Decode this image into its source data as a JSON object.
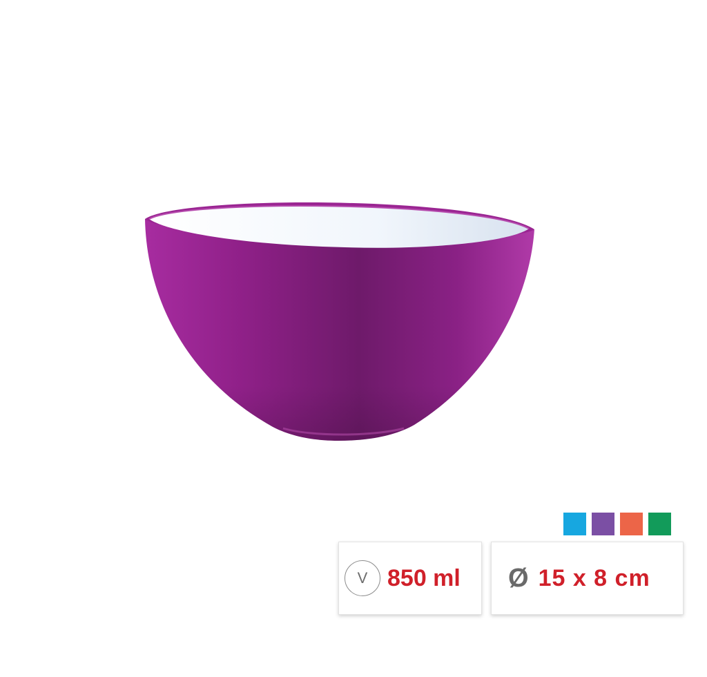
{
  "product": {
    "image_name": "purple-bowl",
    "body_color": "#8c1f85",
    "interior_color": "#eef4fb"
  },
  "color_options": [
    {
      "name": "blue",
      "hex": "#17a7e0"
    },
    {
      "name": "purple",
      "hex": "#7b4fa4"
    },
    {
      "name": "orange",
      "hex": "#ec6548"
    },
    {
      "name": "green",
      "hex": "#129b5a"
    }
  ],
  "specs": {
    "volume_icon": "V",
    "volume": "850 ml",
    "diameter_icon": "Ø",
    "dimensions": "15 x 8 cm"
  }
}
